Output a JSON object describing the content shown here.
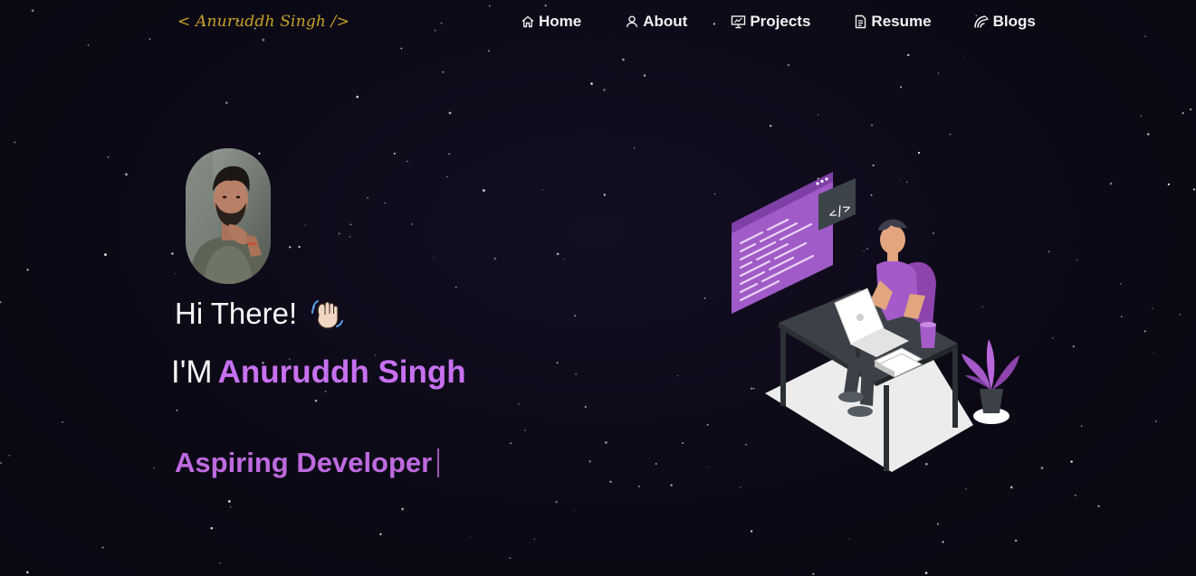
{
  "logo": {
    "text": "< Anuruddh Singh />"
  },
  "nav": {
    "items": [
      {
        "label": "Home",
        "icon": "home-icon"
      },
      {
        "label": "About",
        "icon": "user-icon"
      },
      {
        "label": "Projects",
        "icon": "presentation-icon"
      },
      {
        "label": "Resume",
        "icon": "document-icon"
      },
      {
        "label": "Blogs",
        "icon": "rss-icon"
      }
    ]
  },
  "hero": {
    "greeting": "Hi There!",
    "greeting_emoji": "waving-hand",
    "intro_prefix": "I'M",
    "name": "Anuruddh Singh",
    "typed_text": "Aspiring Developer"
  },
  "colors": {
    "accent": "#c770f0",
    "logo": "#c9a227",
    "background": "#0d0a18"
  }
}
